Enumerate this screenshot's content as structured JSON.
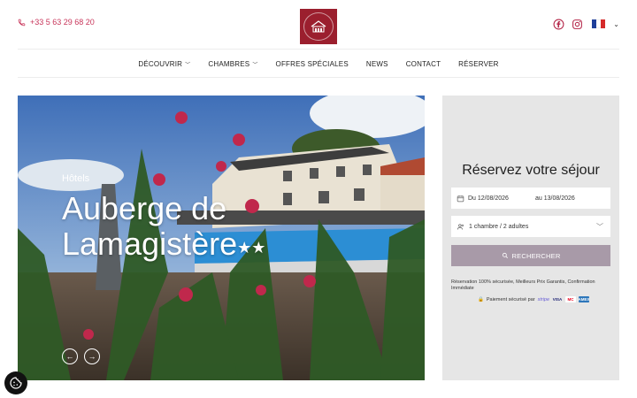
{
  "header": {
    "phone": "+33 5 63 29 68 20",
    "logo_text": "AUBERGE DE LAMAGISTÈRE",
    "social_icons": [
      "facebook-icon",
      "instagram-icon"
    ],
    "language_flag": "fr-flag-icon",
    "brand_color": "#9b1f2e",
    "accent_color": "#c8355a"
  },
  "nav": {
    "items": [
      {
        "label": "DÉCOUVRIR",
        "has_dropdown": true
      },
      {
        "label": "CHAMBRES",
        "has_dropdown": true
      },
      {
        "label": "OFFRES SPÉCIALES",
        "has_dropdown": false
      },
      {
        "label": "NEWS",
        "has_dropdown": false
      },
      {
        "label": "CONTACT",
        "has_dropdown": false
      },
      {
        "label": "RÉSERVER",
        "has_dropdown": false
      }
    ]
  },
  "hero": {
    "subtitle": "Hôtels",
    "title": "Auberge de Lamagistère",
    "stars": "★★",
    "prev_icon": "arrow-left-icon",
    "next_icon": "arrow-right-icon"
  },
  "booking": {
    "title": "Réservez votre séjour",
    "date_from": "Du 12/08/2026",
    "date_to": "au 13/08/2026",
    "guests": "1 chambre / 2 adultes",
    "search_label": "RECHERCHER",
    "note": "Réservation 100% sécurisée, Meilleurs Prix Garantis, Confirmation Immédiate",
    "payment_label": "Paiement sécurisé par",
    "payment_provider": "stripe",
    "cards": [
      "VISA",
      "MC",
      "AMEX"
    ],
    "button_color": "#a89aa8"
  },
  "cookie": {
    "icon": "cookie-icon"
  }
}
